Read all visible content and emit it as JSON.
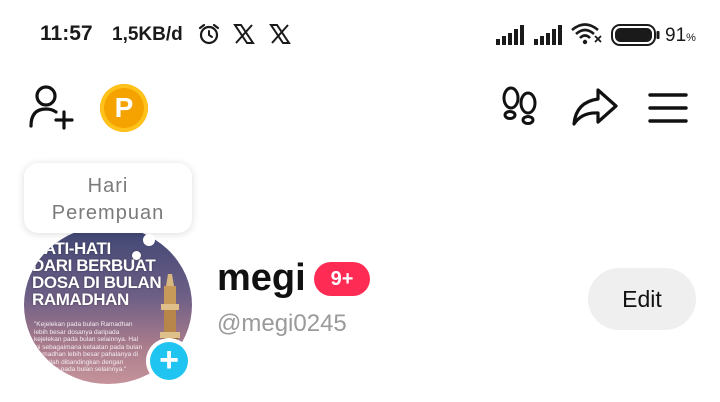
{
  "status_bar": {
    "time": "11:57",
    "speed": "1,5KB/d",
    "icons": [
      "alarm-icon",
      "x-app-icon",
      "x-app-icon",
      "signal-icon",
      "signal-icon",
      "wifi-icon",
      "battery-icon"
    ],
    "battery_value": "91",
    "battery_unit": "%"
  },
  "nav": {
    "icons": [
      "add-user-icon",
      "p-coin-icon",
      "footprints-icon",
      "share-icon",
      "menu-icon"
    ],
    "coin_label": "P"
  },
  "note": {
    "line1": "Hari",
    "line2": "Perempuan"
  },
  "avatar": {
    "title_lines": [
      "HATI-HATI",
      "DARI BERBUAT",
      "DOSA DI BULAN",
      "RAMADHAN"
    ],
    "caption": "\"Kejelekan pada bulan Ramadhan lebih besar dosanya daripada kejelekan pada bulan selainnya. Hal ini sebagaimana ketaatan pada bulan Ramadhan lebih besar pahalanya di sisi Allah dibandingkan dengan ketaatan pada bulan selainnya.\""
  },
  "profile": {
    "username": "megi",
    "badge": "9+",
    "handle": "@megi0245",
    "edit_label": "Edit"
  },
  "colors": {
    "accent_red": "#fe2c55",
    "story_blue": "#20c4f0",
    "coin_orange": "#f4a300"
  }
}
